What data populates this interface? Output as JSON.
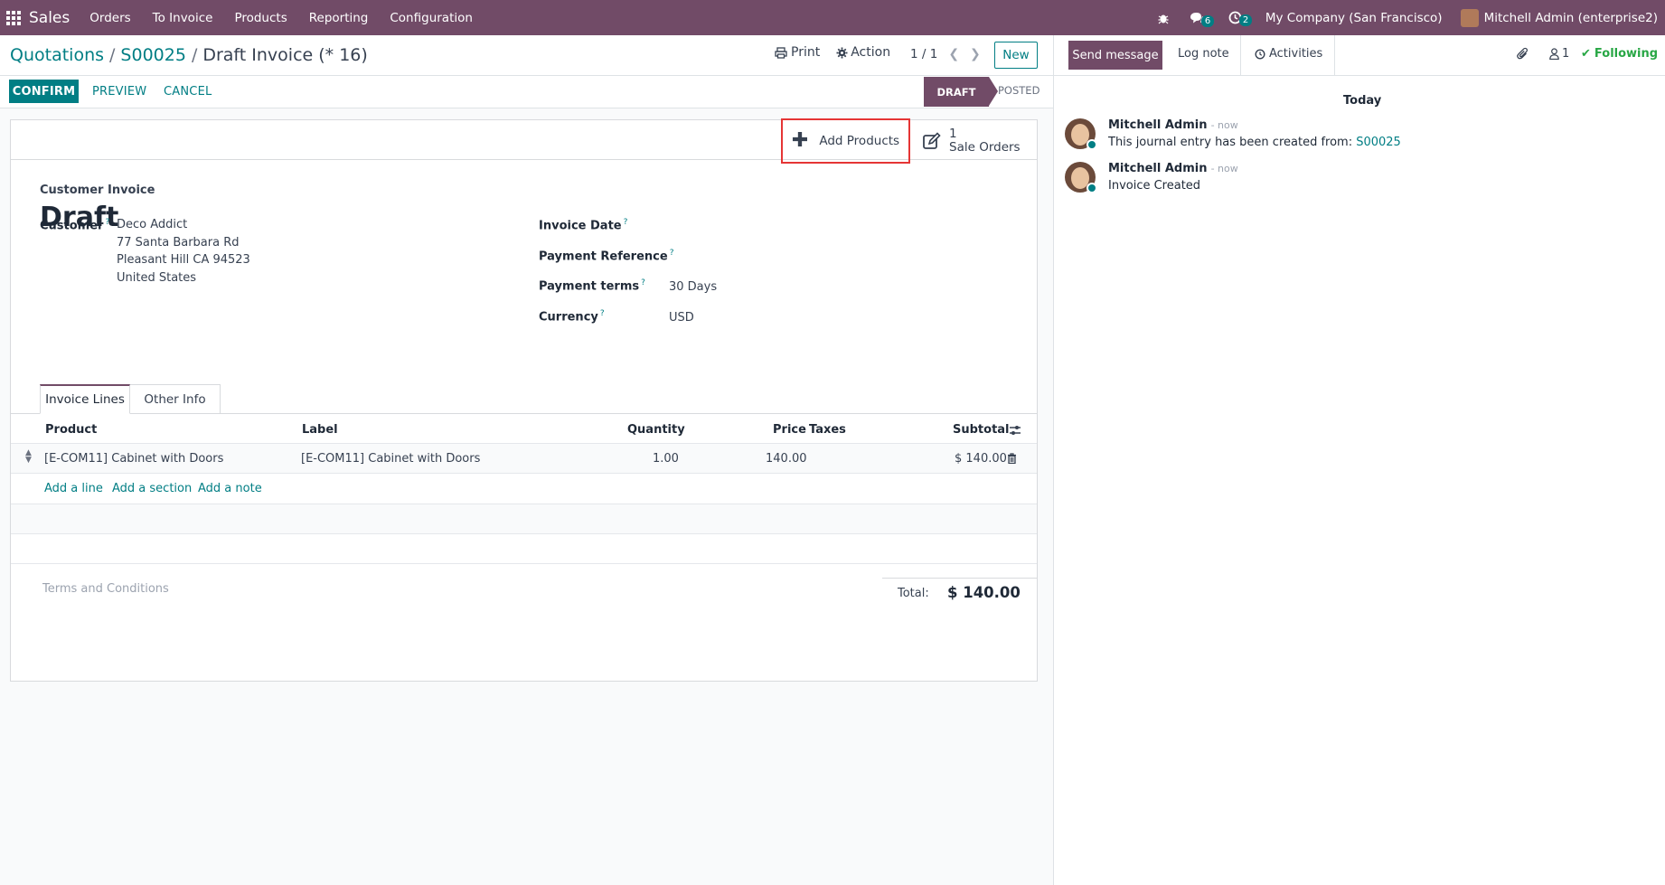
{
  "navbar": {
    "app_name": "Sales",
    "menu": [
      "Orders",
      "To Invoice",
      "Products",
      "Reporting",
      "Configuration"
    ],
    "messages_badge": "6",
    "activities_badge": "2",
    "company": "My Company (San Francisco)",
    "user": "Mitchell Admin (enterprise2)"
  },
  "breadcrumb": {
    "items": [
      "Quotations",
      "S00025"
    ],
    "current": "Draft Invoice (* 16)"
  },
  "control_panel": {
    "print": "Print",
    "action": "Action",
    "pager": "1 / 1",
    "new": "New"
  },
  "statusbar": {
    "confirm": "CONFIRM",
    "preview": "PREVIEW",
    "cancel": "CANCEL",
    "stages": [
      "DRAFT",
      "POSTED"
    ],
    "active_stage": "DRAFT"
  },
  "button_box": {
    "add_products": "Add Products",
    "sale_orders_count": "1",
    "sale_orders_label": "Sale Orders"
  },
  "form": {
    "type_label": "Customer Invoice",
    "state_title": "Draft",
    "customer_label": "Customer",
    "customer_name": "Deco Addict",
    "customer_address": [
      "77 Santa Barbara Rd",
      "Pleasant Hill CA 94523",
      "United States"
    ],
    "invoice_date_label": "Invoice Date",
    "payment_reference_label": "Payment Reference",
    "payment_terms_label": "Payment terms",
    "payment_terms_value": "30 Days",
    "currency_label": "Currency",
    "currency_value": "USD",
    "help_mark": "?"
  },
  "tabs": [
    "Invoice Lines",
    "Other Info"
  ],
  "lines": {
    "headers": [
      "Product",
      "Label",
      "Quantity",
      "Price",
      "Taxes",
      "Subtotal"
    ],
    "rows": [
      {
        "product": "[E-COM11] Cabinet with Doors",
        "label": "[E-COM11] Cabinet with Doors",
        "quantity": "1.00",
        "price": "140.00",
        "taxes": "",
        "subtotal": "$ 140.00"
      }
    ],
    "add_line": "Add a line",
    "add_section": "Add a section",
    "add_note": "Add a note"
  },
  "footer": {
    "terms_placeholder": "Terms and Conditions",
    "total_label": "Total:",
    "total_value": "$ 140.00"
  },
  "chatter": {
    "send_message": "Send message",
    "log_note": "Log note",
    "activities": "Activities",
    "followers_count": "1",
    "following": "Following",
    "date_separator": "Today",
    "messages": [
      {
        "author": "Mitchell Admin",
        "time": "- now",
        "body_prefix": "This journal entry has been created from: ",
        "body_link": "S00025"
      },
      {
        "author": "Mitchell Admin",
        "time": "- now",
        "body_prefix": "Invoice Created",
        "body_link": ""
      }
    ]
  },
  "colors": {
    "brand": "#714b67",
    "accent": "#017e84",
    "highlight_border": "#e53535",
    "following": "#28a745"
  }
}
